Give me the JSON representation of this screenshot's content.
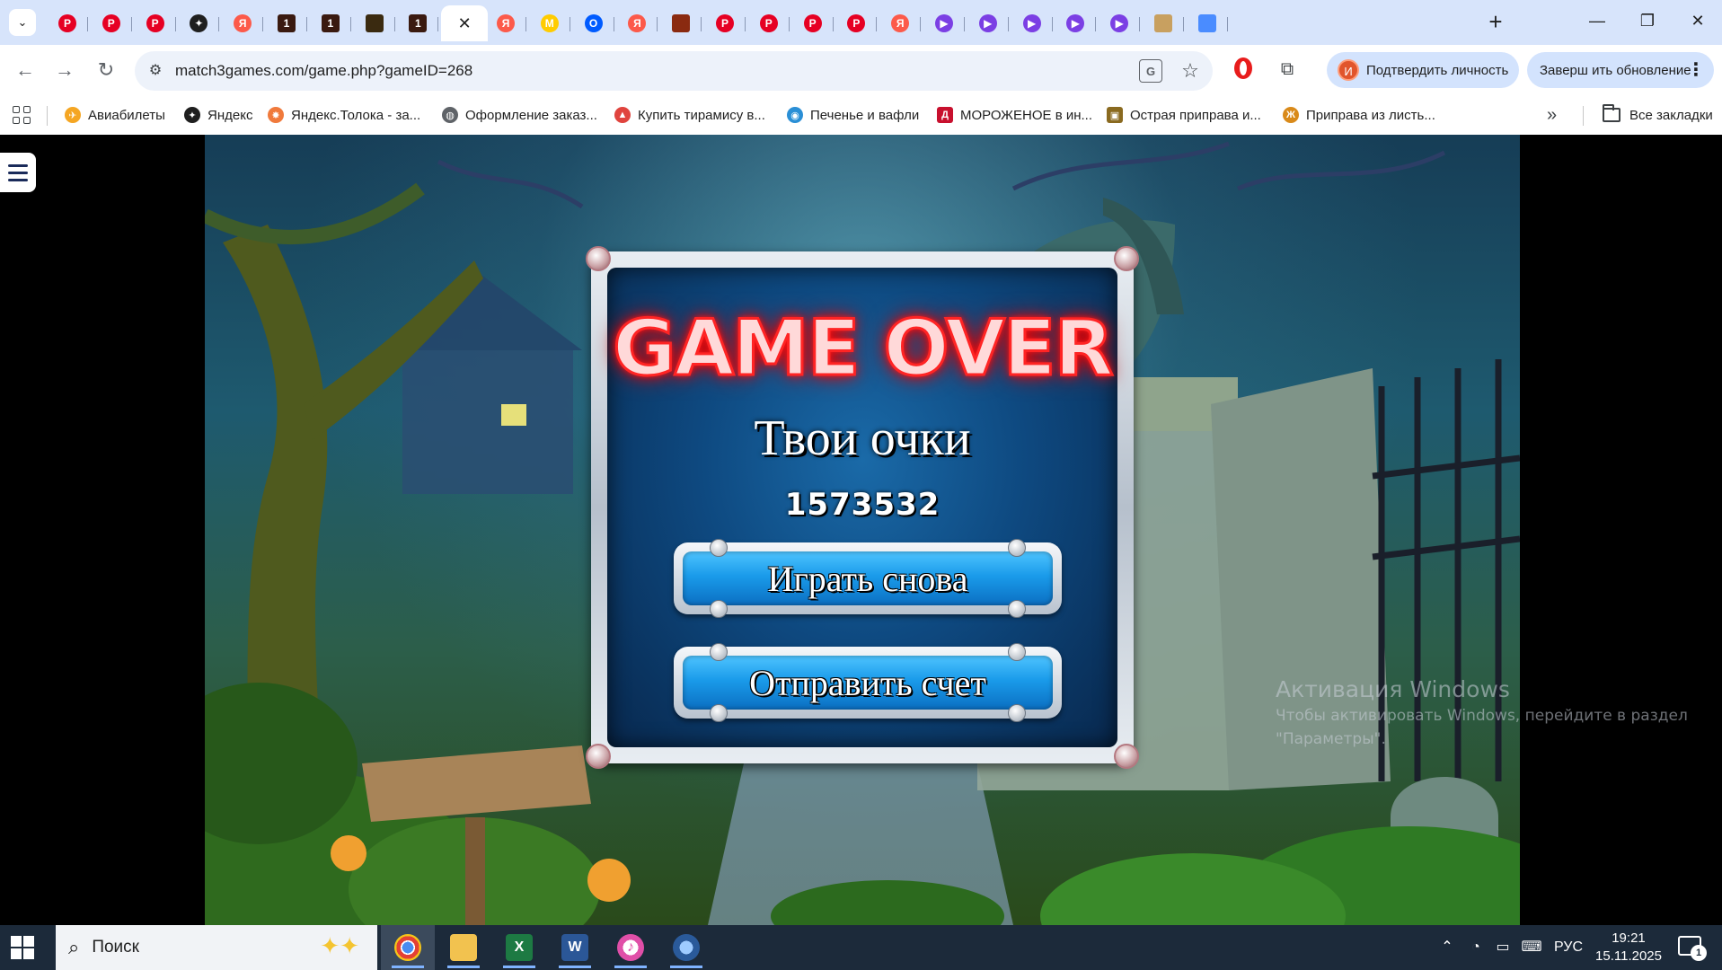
{
  "browser": {
    "url": "match3games.com/game.php?gameID=268",
    "verify_identity_label": "Подтвердить личность",
    "verify_avatar_letter": "И",
    "update_label": "Заверш ить обновление",
    "tabs": [
      {
        "icon": "pinterest-icon",
        "color": "#e60023",
        "glyph": "P"
      },
      {
        "icon": "pinterest-icon",
        "color": "#e60023",
        "glyph": "P"
      },
      {
        "icon": "pinterest-icon",
        "color": "#e60023",
        "glyph": "P"
      },
      {
        "icon": "star-dark-icon",
        "color": "#1f1f1f",
        "glyph": "✦"
      },
      {
        "icon": "yandex-icon",
        "color": "#fc5a4a",
        "glyph": "Я"
      },
      {
        "icon": "game-thumb-icon",
        "color": "#3a1a10",
        "glyph": "1"
      },
      {
        "icon": "game-thumb-icon",
        "color": "#3a1a10",
        "glyph": "1"
      },
      {
        "icon": "game-thumb-icon",
        "color": "#3a2a10",
        "glyph": ""
      },
      {
        "icon": "game-thumb-icon",
        "color": "#3a1a10",
        "glyph": "1"
      },
      {
        "icon": "active-tab",
        "color": "#ffffff",
        "glyph": "✕"
      },
      {
        "icon": "yandex-icon",
        "color": "#fc5a4a",
        "glyph": "Я"
      },
      {
        "icon": "market-icon",
        "color": "#ffcc00",
        "glyph": "M"
      },
      {
        "icon": "ozon-icon",
        "color": "#005bff",
        "glyph": "O"
      },
      {
        "icon": "yandex-icon",
        "color": "#fc5a4a",
        "glyph": "Я"
      },
      {
        "icon": "game-thumb-icon",
        "color": "#8a2a10",
        "glyph": ""
      },
      {
        "icon": "pinterest-icon",
        "color": "#e60023",
        "glyph": "P"
      },
      {
        "icon": "pinterest-icon",
        "color": "#e60023",
        "glyph": "P"
      },
      {
        "icon": "pinterest-icon",
        "color": "#e60023",
        "glyph": "P"
      },
      {
        "icon": "pinterest-icon",
        "color": "#e60023",
        "glyph": "P"
      },
      {
        "icon": "yandex-icon",
        "color": "#fc5a4a",
        "glyph": "Я"
      },
      {
        "icon": "video-play-icon",
        "color": "#7b3fe4",
        "glyph": "▶"
      },
      {
        "icon": "video-play-icon",
        "color": "#7b3fe4",
        "glyph": "▶"
      },
      {
        "icon": "video-play-icon",
        "color": "#7b3fe4",
        "glyph": "▶"
      },
      {
        "icon": "video-play-icon",
        "color": "#7b3fe4",
        "glyph": "▶"
      },
      {
        "icon": "video-play-icon",
        "color": "#7b3fe4",
        "glyph": "▶"
      },
      {
        "icon": "image-thumb-icon",
        "color": "#c8a060",
        "glyph": ""
      },
      {
        "icon": "photos-icon",
        "color": "#4a8cff",
        "glyph": ""
      }
    ]
  },
  "bookmarks": [
    {
      "label": "Авиабилеты",
      "icon": "plane-icon",
      "color": "#f5a623",
      "glyph": "✈"
    },
    {
      "label": "Яндекс",
      "icon": "yandex-star-icon",
      "color": "#1f1f1f",
      "glyph": "✦"
    },
    {
      "label": "Яндекс.Толока - за...",
      "icon": "toloka-icon",
      "color": "#f07a3c",
      "glyph": "✸"
    },
    {
      "label": "Оформление заказ...",
      "icon": "globe-icon",
      "color": "#5f6368",
      "glyph": "◍"
    },
    {
      "label": "Купить тирамису в...",
      "icon": "cake-icon",
      "color": "#e0443e",
      "glyph": "▲"
    },
    {
      "label": "Печенье и вафли",
      "icon": "cookie-icon",
      "color": "#2a8fd6",
      "glyph": "◉"
    },
    {
      "label": "МОРОЖЕНОЕ в ин...",
      "icon": "shop-icon",
      "color": "#c8102e",
      "glyph": "Д"
    },
    {
      "label": "Острая приправа и...",
      "icon": "spice-icon",
      "color": "#8a6a20",
      "glyph": "▣"
    },
    {
      "label": "Приправа из листь...",
      "icon": "leaf-icon",
      "color": "#d98a1a",
      "glyph": "Ж"
    }
  ],
  "all_bookmarks_label": "Все закладки",
  "game": {
    "title": "GAME OVER",
    "score_label": "Твои очки",
    "score": "1573532",
    "play_again_label": "Играть снова",
    "submit_score_label": "Отправить счет"
  },
  "watermark": {
    "title": "Активация Windows",
    "text": "Чтобы активировать Windows, перейдите в раздел \"Параметры\"."
  },
  "taskbar": {
    "search_placeholder": "Поиск",
    "apps": [
      {
        "icon": "chrome-icon",
        "active": true
      },
      {
        "icon": "file-explorer-icon",
        "active": false
      },
      {
        "icon": "excel-icon",
        "active": false
      },
      {
        "icon": "word-icon",
        "active": false
      },
      {
        "icon": "itunes-icon",
        "active": false
      },
      {
        "icon": "app-icon",
        "active": false
      }
    ],
    "language": "РУС",
    "time": "19:21",
    "date": "15.11.2025",
    "notification_count": "1"
  }
}
